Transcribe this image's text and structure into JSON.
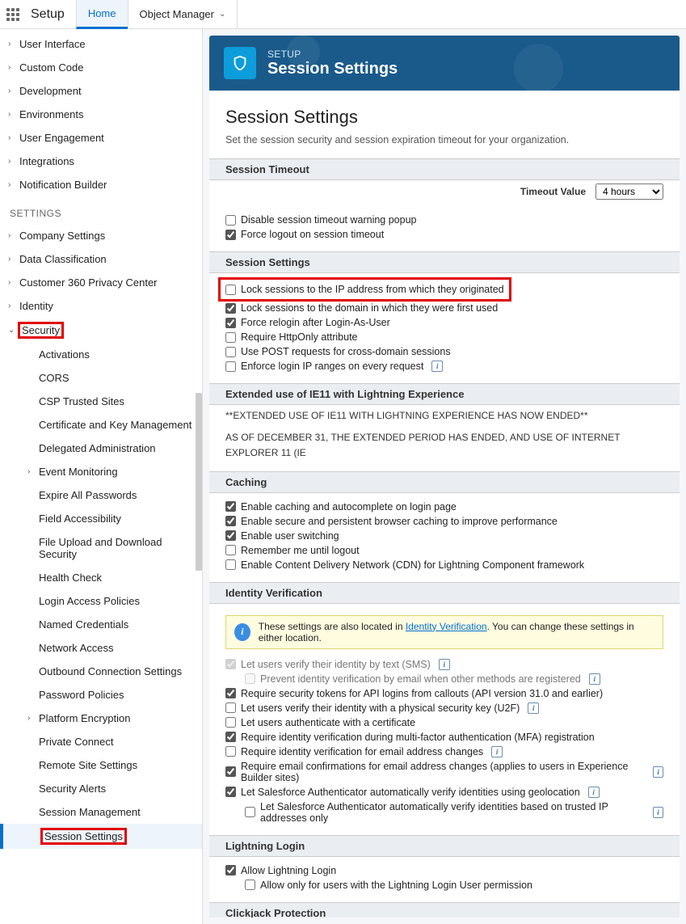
{
  "topbar": {
    "title": "Setup",
    "tabs": [
      {
        "label": "Home",
        "active": true
      },
      {
        "label": "Object Manager",
        "chevron": true
      }
    ]
  },
  "sidebar": {
    "top_items": [
      "User Interface",
      "Custom Code",
      "Development",
      "Environments",
      "User Engagement",
      "Integrations",
      "Notification Builder"
    ],
    "settings_heading": "SETTINGS",
    "settings_items": [
      "Company Settings",
      "Data Classification",
      "Customer 360 Privacy Center",
      "Identity"
    ],
    "security_label": "Security",
    "security_children": [
      {
        "label": "Activations"
      },
      {
        "label": "CORS"
      },
      {
        "label": "CSP Trusted Sites"
      },
      {
        "label": "Certificate and Key Management"
      },
      {
        "label": "Delegated Administration"
      },
      {
        "label": "Event Monitoring",
        "expandable": true
      },
      {
        "label": "Expire All Passwords"
      },
      {
        "label": "Field Accessibility"
      },
      {
        "label": "File Upload and Download Security"
      },
      {
        "label": "Health Check"
      },
      {
        "label": "Login Access Policies"
      },
      {
        "label": "Named Credentials"
      },
      {
        "label": "Network Access"
      },
      {
        "label": "Outbound Connection Settings"
      },
      {
        "label": "Password Policies"
      },
      {
        "label": "Platform Encryption",
        "expandable": true
      },
      {
        "label": "Private Connect"
      },
      {
        "label": "Remote Site Settings"
      },
      {
        "label": "Security Alerts"
      },
      {
        "label": "Session Management"
      },
      {
        "label": "Session Settings",
        "active": true,
        "highlight": true
      }
    ]
  },
  "hero": {
    "eyebrow": "SETUP",
    "title": "Session Settings"
  },
  "page": {
    "h1": "Session Settings",
    "sub": "Set the session security and session expiration timeout for your organization."
  },
  "sections": {
    "timeout": {
      "header": "Session Timeout",
      "timeout_label": "Timeout Value",
      "timeout_value": "4 hours",
      "checks": [
        {
          "label": "Disable session timeout warning popup",
          "checked": false
        },
        {
          "label": "Force logout on session timeout",
          "checked": true
        }
      ]
    },
    "session": {
      "header": "Session Settings",
      "checks": [
        {
          "label": "Lock sessions to the IP address from which they originated",
          "checked": false,
          "highlight": true
        },
        {
          "label": "Lock sessions to the domain in which they were first used",
          "checked": true
        },
        {
          "label": "Force relogin after Login-As-User",
          "checked": true
        },
        {
          "label": "Require HttpOnly attribute",
          "checked": false
        },
        {
          "label": "Use POST requests for cross-domain sessions",
          "checked": false
        },
        {
          "label": "Enforce login IP ranges on every request",
          "checked": false,
          "info": true
        }
      ]
    },
    "ie11": {
      "header": "Extended use of IE11 with Lightning Experience",
      "line1": "**EXTENDED USE OF IE11 WITH LIGHTNING EXPERIENCE HAS NOW ENDED**",
      "line2": "AS OF DECEMBER 31, THE EXTENDED PERIOD HAS ENDED, AND USE OF INTERNET EXPLORER 11 (IE"
    },
    "caching": {
      "header": "Caching",
      "checks": [
        {
          "label": "Enable caching and autocomplete on login page",
          "checked": true
        },
        {
          "label": "Enable secure and persistent browser caching to improve performance",
          "checked": true
        },
        {
          "label": "Enable user switching",
          "checked": true
        },
        {
          "label": "Remember me until logout",
          "checked": false
        },
        {
          "label": "Enable Content Delivery Network (CDN) for Lightning Component framework",
          "checked": false
        }
      ]
    },
    "identity": {
      "header": "Identity Verification",
      "callout_pre": "These settings are also located in ",
      "callout_link": "Identity Verification",
      "callout_post": ". You can change these settings in either location.",
      "checks": [
        {
          "label": "Let users verify their identity by text (SMS)",
          "checked": true,
          "disabled": true,
          "info": true
        },
        {
          "label": "Prevent identity verification by email when other methods are registered",
          "checked": false,
          "disabled": true,
          "indent": true,
          "info": true
        },
        {
          "label": "Require security tokens for API logins from callouts (API version 31.0 and earlier)",
          "checked": true
        },
        {
          "label": "Let users verify their identity with a physical security key (U2F)",
          "checked": false,
          "info": true
        },
        {
          "label": "Let users authenticate with a certificate",
          "checked": false
        },
        {
          "label": "Require identity verification during multi-factor authentication (MFA) registration",
          "checked": true
        },
        {
          "label": "Require identity verification for email address changes",
          "checked": false,
          "info": true
        },
        {
          "label": "Require email confirmations for email address changes (applies to users in Experience Builder sites)",
          "checked": true,
          "info": true
        },
        {
          "label": "Let Salesforce Authenticator automatically verify identities using geolocation",
          "checked": true,
          "info": true
        },
        {
          "label": "Let Salesforce Authenticator automatically verify identities based on trusted IP addresses only",
          "checked": false,
          "indent": true,
          "info": true
        }
      ]
    },
    "lightning": {
      "header": "Lightning Login",
      "checks": [
        {
          "label": "Allow Lightning Login",
          "checked": true
        },
        {
          "label": "Allow only for users with the Lightning Login User permission",
          "checked": false,
          "indent": true
        }
      ]
    },
    "clickjack": {
      "header": "Clickjack Protection"
    }
  }
}
